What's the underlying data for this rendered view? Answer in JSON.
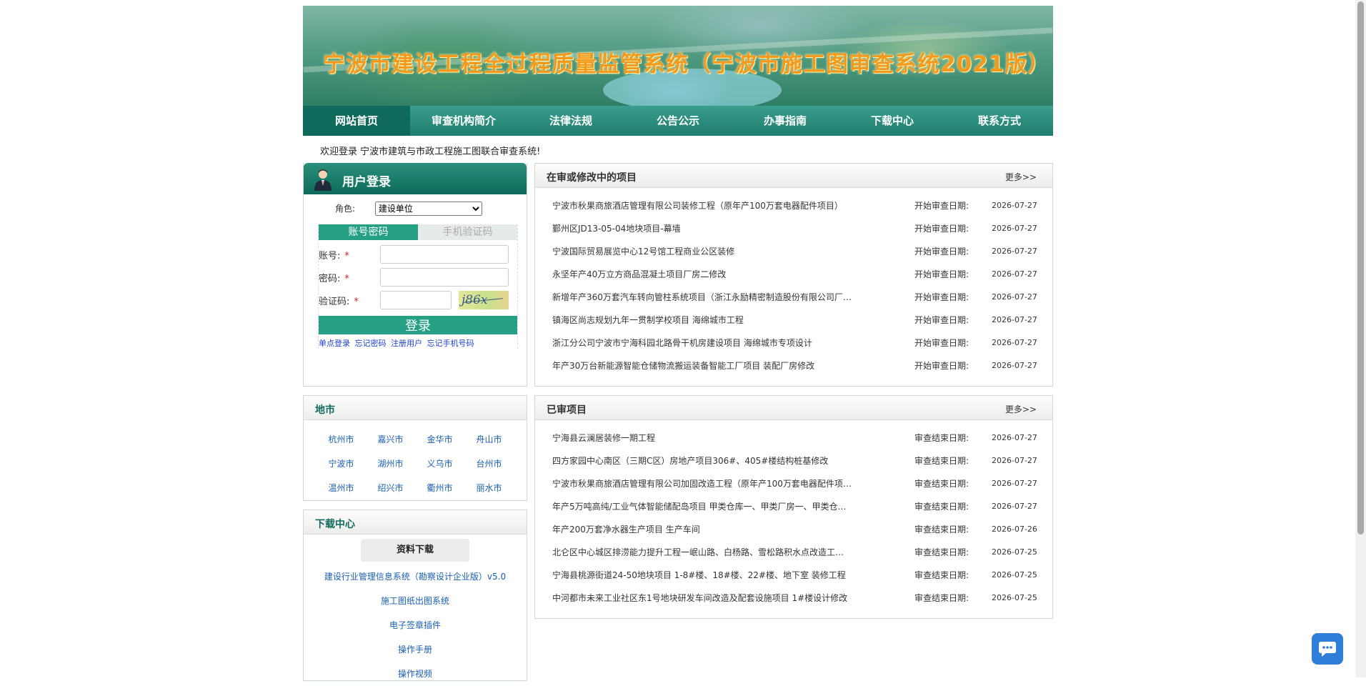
{
  "banner": {
    "title": "宁波市建设工程全过程质量监管系统（宁波市施工图审查系统2021版）"
  },
  "nav": [
    "网站首页",
    "审查机构简介",
    "法律法规",
    "公告公示",
    "办事指南",
    "下载中心",
    "联系方式"
  ],
  "welcome": "欢迎登录 宁波市建筑与市政工程施工图联合审查系统!",
  "login": {
    "title": "用户登录",
    "role_label": "角色:",
    "role_value": "建设单位",
    "tab_password": "账号密码",
    "tab_sms": "手机验证码",
    "account_label": "账号:",
    "password_label": "密码:",
    "captcha_label": "验证码:",
    "required": "*",
    "captcha_text": "j86x",
    "submit": "登录",
    "links": [
      "单点登录",
      "忘记密码",
      "注册用户",
      "忘记手机号码"
    ]
  },
  "cities": {
    "title": "地市",
    "items": [
      "杭州市",
      "嘉兴市",
      "金华市",
      "舟山市",
      "宁波市",
      "湖州市",
      "义乌市",
      "台州市",
      "温州市",
      "绍兴市",
      "衢州市",
      "丽水市"
    ]
  },
  "downloads": {
    "title": "下载中心",
    "button": "资料下载",
    "items": [
      "建设行业管理信息系统（勘察设计企业版）v5.0",
      "施工图纸出图系统",
      "电子签章插件",
      "操作手册",
      "操作视频"
    ]
  },
  "in_review": {
    "title": "在审或修改中的项目",
    "more": "更多>>",
    "date_label": "开始审查日期:",
    "items": [
      {
        "name": "宁波市秋果商旅酒店管理有限公司装修工程（原年产100万套电器配件项目）",
        "date": "2026-07-27"
      },
      {
        "name": "鄞州区JD13-05-04地块项目-幕墙",
        "date": "2026-07-27"
      },
      {
        "name": "宁波国际贸易展览中心12号馆工程商业公区装修",
        "date": "2026-07-27"
      },
      {
        "name": "永坚年产40万立方商品混凝土项目厂房二修改",
        "date": "2026-07-27"
      },
      {
        "name": "新增年产360万套汽车转向管柱系统项目（浙江永励精密制造股份有限公司厂…",
        "date": "2026-07-27"
      },
      {
        "name": "镇海区尚志规划九年一贯制学校项目 海绵城市工程",
        "date": "2026-07-27"
      },
      {
        "name": "浙江分公司宁波市宁海科园北路骨干机房建设项目 海绵城市专项设计",
        "date": "2026-07-27"
      },
      {
        "name": "年产30万台新能源智能仓储物流搬运装备智能工厂项目 装配厂房修改",
        "date": "2026-07-27"
      }
    ]
  },
  "reviewed": {
    "title": "已审项目",
    "more": "更多>>",
    "date_label": "审查结束日期:",
    "items": [
      {
        "name": "宁海县云澜居装修一期工程",
        "date": "2026-07-27"
      },
      {
        "name": "四方家园中心南区（三期C区）房地产项目306#、405#楼结构桩基修改",
        "date": "2026-07-27"
      },
      {
        "name": "宁波市秋果商旅酒店管理有限公司加固改造工程（原年产100万套电器配件项…",
        "date": "2026-07-27"
      },
      {
        "name": "年产5万吨高纯/工业气体智能储配岛项目 甲类仓库一、甲类厂房一、甲类仓…",
        "date": "2026-07-27"
      },
      {
        "name": "年产200万套净水器生产项目 生产车间",
        "date": "2026-07-26"
      },
      {
        "name": "北仑区中心城区排涝能力提升工程一岷山路、白杨路、雪松路积水点改造工…",
        "date": "2026-07-25"
      },
      {
        "name": "宁海县桃源街道24-50地块项目 1-8#楼、18#楼、22#楼、地下室 装修工程",
        "date": "2026-07-25"
      },
      {
        "name": "中河都市未来工业社区东1号地块研发车间改造及配套设施项目 1#楼设计修改",
        "date": "2026-07-25"
      }
    ]
  }
}
